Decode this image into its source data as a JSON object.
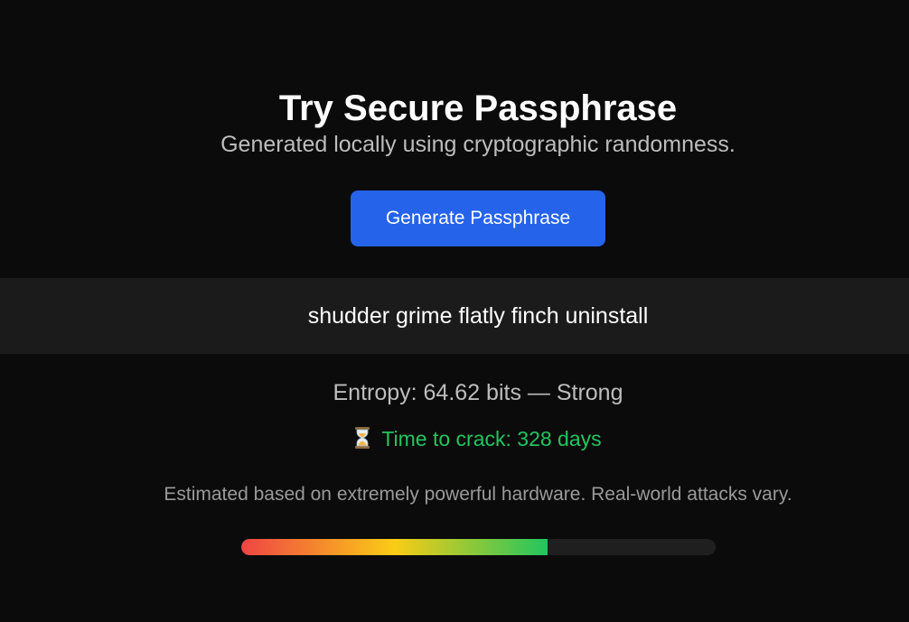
{
  "header": {
    "title": "Try Secure Passphrase",
    "subtitle": "Generated locally using cryptographic randomness."
  },
  "generate_button": {
    "label": "Generate Passphrase"
  },
  "passphrase": {
    "value": "shudder grime flatly finch uninstall"
  },
  "stats": {
    "entropy_text": "Entropy: 64.62 bits — Strong",
    "crack_icon": "hourglass-icon",
    "crack_text": "Time to crack: 328 days",
    "note": "Estimated based on extremely powerful hardware. Real-world attacks vary."
  },
  "strength_meter": {
    "fill_fraction": 0.646,
    "gradient_colors": [
      "#ef4444",
      "#facc15",
      "#22c55e"
    ],
    "track_color": "#1f1f1f"
  },
  "colors": {
    "accent": "#2563eb",
    "success": "#22c55e",
    "background": "#0b0b0b"
  }
}
